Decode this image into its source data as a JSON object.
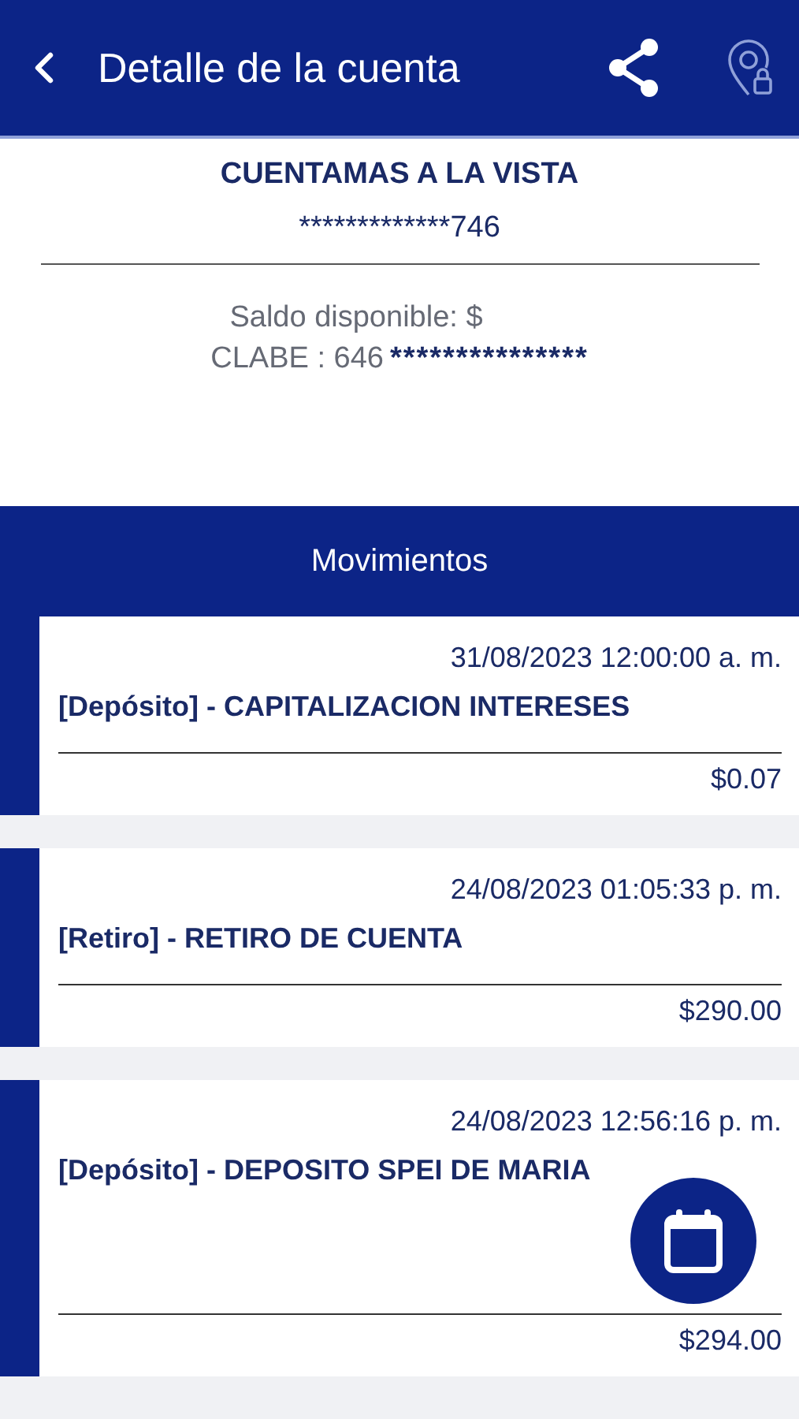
{
  "header": {
    "title": "Detalle de la cuenta"
  },
  "account": {
    "name": "CUENTAMAS A LA VISTA",
    "number": "*************746",
    "balance_label": "Saldo disponible: $",
    "clabe_label": "CLABE : 646",
    "clabe_masked": "***************"
  },
  "movements": {
    "title": "Movimientos",
    "items": [
      {
        "date": "31/08/2023 12:00:00 a. m.",
        "description": "[Depósito] - CAPITALIZACION INTERESES",
        "amount": "$0.07"
      },
      {
        "date": "24/08/2023 01:05:33 p. m.",
        "description": "[Retiro] - RETIRO DE CUENTA",
        "amount": "$290.00"
      },
      {
        "date": "24/08/2023 12:56:16 p. m.",
        "description": "[Depósito] - DEPOSITO SPEI DE MARIA",
        "amount": "$294.00"
      }
    ]
  }
}
